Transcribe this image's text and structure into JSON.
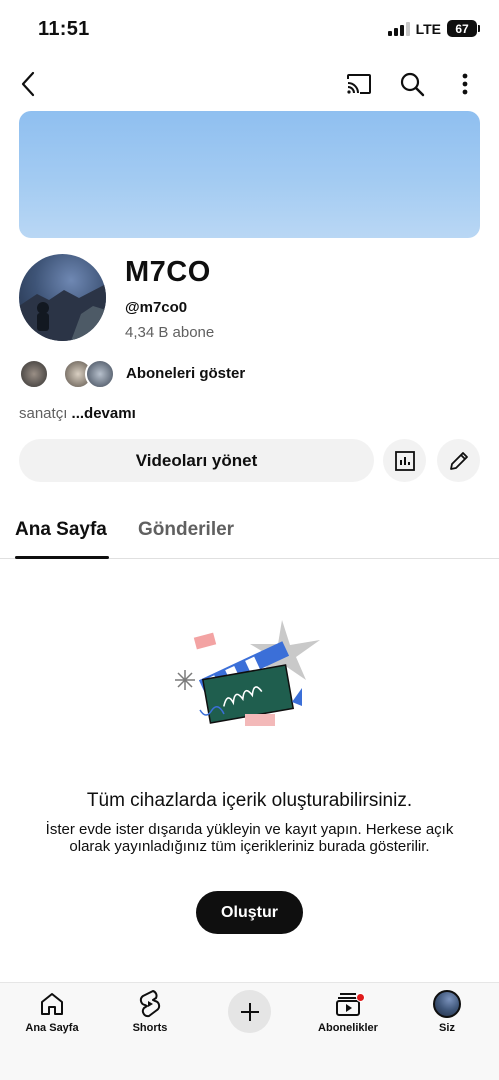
{
  "status_bar": {
    "time": "11:51",
    "network": "LTE",
    "battery": "67"
  },
  "channel": {
    "name": "M7CO",
    "handle": "@m7co0",
    "subscribers": "4,34 B abone",
    "show_subscribers_label": "Aboneleri göster",
    "description": "sanatçı",
    "more_label": "...devamı"
  },
  "actions": {
    "manage_videos_label": "Videoları yönet"
  },
  "tabs": [
    {
      "label": "Ana Sayfa",
      "active": true
    },
    {
      "label": "Gönderiler",
      "active": false
    }
  ],
  "empty_state": {
    "title": "Tüm cihazlarda içerik oluşturabilirsiniz.",
    "body": "İster evde ister dışarıda yükleyin ve kayıt yapın. Herkese açık olarak yayınladığınız tüm içerikleriniz burada gösterilir.",
    "button_label": "Oluştur"
  },
  "bottom_nav": [
    {
      "label": "Ana Sayfa",
      "icon": "home-icon"
    },
    {
      "label": "Shorts",
      "icon": "shorts-icon"
    },
    {
      "label": "",
      "icon": "plus-icon"
    },
    {
      "label": "Abonelikler",
      "icon": "subscriptions-icon"
    },
    {
      "label": "Siz",
      "icon": "avatar"
    }
  ],
  "colors": {
    "banner": "#a3cbf2",
    "notification": "#e01b1b",
    "text": "#0f0f0f",
    "secondary_text": "#606060"
  }
}
